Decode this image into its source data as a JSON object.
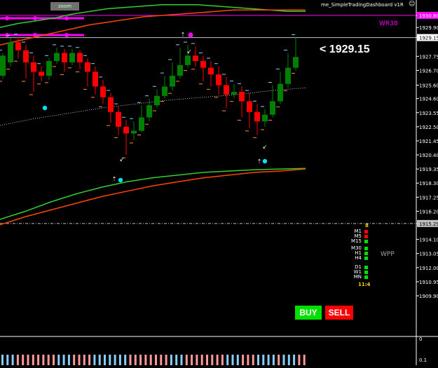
{
  "indicator_title": "me_SimpleTradingDashboard v1R",
  "indicator_button": "zoom",
  "current_price_label": "< 1929.15",
  "wr_label": "WR38",
  "wpp_label": "WPP",
  "buy_label": "BUY",
  "sell_label": "SELL",
  "price_axis": {
    "labels": [
      "1930.80",
      "1929.90",
      "1929.15",
      "1927.75",
      "1926.70",
      "1925.60",
      "1924.60",
      "1923.55",
      "1922.50",
      "1921.45",
      "1920.40",
      "1919.35",
      "1918.30",
      "1917.25",
      "1916.20",
      "1915.29",
      "1914.10",
      "1913.05",
      "1912.00",
      "1910.95",
      "1909.90"
    ]
  },
  "wr_price": "1930.80",
  "current_price": "1929.15",
  "wpp_price": "1915.29",
  "sub_axis": {
    "top": "0",
    "bottom": "0.1"
  },
  "dashboard": {
    "header": "8",
    "rows": [
      {
        "tf": "M1",
        "color": "#ff0000"
      },
      {
        "tf": "M5",
        "color": "#ff0000"
      },
      {
        "tf": "M15",
        "color": "#00e000"
      },
      {
        "tf": "M30",
        "color": "#00e000"
      },
      {
        "tf": "H1",
        "color": "#00e000"
      },
      {
        "tf": "H4",
        "color": "#00e000"
      },
      {
        "tf": "D1",
        "color": "#00e000"
      },
      {
        "tf": "W1",
        "color": "#00e000"
      },
      {
        "tf": "MN",
        "color": "#00e000"
      }
    ],
    "timer": "11:4"
  },
  "colors": {
    "bull": "#008000",
    "bear": "#ff0000",
    "ma_fast": "#32cd32",
    "ma_slow": "#ff4500",
    "magenta": "#ff00ff",
    "dot": "#00e0ff",
    "wick_bull": "#87cefa",
    "wick_bear": "#ff8c40",
    "sub_bull": "#87cefa",
    "sub_bear": "#ff9999"
  },
  "chart_data": {
    "type": "candlestick",
    "candles": [
      {
        "o": 1926.3,
        "c": 1927.8,
        "h": 1928.0,
        "l": 1926.1
      },
      {
        "o": 1927.3,
        "c": 1928.8,
        "h": 1929.1,
        "l": 1927.0
      },
      {
        "o": 1928.8,
        "c": 1928.2,
        "h": 1929.2,
        "l": 1927.6
      },
      {
        "o": 1928.2,
        "c": 1927.3,
        "h": 1928.6,
        "l": 1926.1
      },
      {
        "o": 1927.3,
        "c": 1926.6,
        "h": 1927.8,
        "l": 1925.1
      },
      {
        "o": 1926.6,
        "c": 1926.3,
        "h": 1927.0,
        "l": 1925.9
      },
      {
        "o": 1926.3,
        "c": 1927.4,
        "h": 1927.6,
        "l": 1926.0
      },
      {
        "o": 1927.4,
        "c": 1928.0,
        "h": 1928.4,
        "l": 1927.2
      },
      {
        "o": 1928.0,
        "c": 1927.3,
        "h": 1928.3,
        "l": 1926.6
      },
      {
        "o": 1927.3,
        "c": 1928.0,
        "h": 1928.3,
        "l": 1927.1
      },
      {
        "o": 1928.0,
        "c": 1927.3,
        "h": 1928.2,
        "l": 1926.8
      },
      {
        "o": 1927.3,
        "c": 1926.6,
        "h": 1927.6,
        "l": 1925.5
      },
      {
        "o": 1926.6,
        "c": 1925.5,
        "h": 1927.0,
        "l": 1924.9
      },
      {
        "o": 1925.5,
        "c": 1924.7,
        "h": 1926.0,
        "l": 1924.2
      },
      {
        "o": 1924.7,
        "c": 1923.6,
        "h": 1925.0,
        "l": 1922.8
      },
      {
        "o": 1923.6,
        "c": 1922.5,
        "h": 1924.0,
        "l": 1921.9
      },
      {
        "o": 1922.5,
        "c": 1922.0,
        "h": 1923.0,
        "l": 1920.4
      },
      {
        "o": 1922.0,
        "c": 1922.2,
        "h": 1922.9,
        "l": 1921.5
      },
      {
        "o": 1922.2,
        "c": 1923.2,
        "h": 1924.1,
        "l": 1922.1
      },
      {
        "o": 1923.2,
        "c": 1924.1,
        "h": 1924.6,
        "l": 1922.9
      },
      {
        "o": 1924.1,
        "c": 1924.8,
        "h": 1925.3,
        "l": 1923.9
      },
      {
        "o": 1924.8,
        "c": 1925.5,
        "h": 1926.3,
        "l": 1924.6
      },
      {
        "o": 1925.5,
        "c": 1926.3,
        "h": 1927.3,
        "l": 1925.2
      },
      {
        "o": 1926.3,
        "c": 1927.1,
        "h": 1928.4,
        "l": 1926.1
      },
      {
        "o": 1927.1,
        "c": 1927.8,
        "h": 1928.6,
        "l": 1926.9
      },
      {
        "o": 1927.8,
        "c": 1927.4,
        "h": 1928.5,
        "l": 1927.0
      },
      {
        "o": 1927.4,
        "c": 1926.9,
        "h": 1927.8,
        "l": 1925.9
      },
      {
        "o": 1926.9,
        "c": 1926.4,
        "h": 1927.4,
        "l": 1925.5
      },
      {
        "o": 1926.4,
        "c": 1925.6,
        "h": 1927.0,
        "l": 1924.9
      },
      {
        "o": 1925.6,
        "c": 1924.9,
        "h": 1926.2,
        "l": 1923.9
      },
      {
        "o": 1924.9,
        "c": 1925.1,
        "h": 1925.7,
        "l": 1924.6
      },
      {
        "o": 1925.1,
        "c": 1924.4,
        "h": 1925.5,
        "l": 1923.2
      },
      {
        "o": 1924.4,
        "c": 1923.6,
        "h": 1925.0,
        "l": 1922.4
      },
      {
        "o": 1923.6,
        "c": 1922.9,
        "h": 1924.2,
        "l": 1921.9
      },
      {
        "o": 1922.9,
        "c": 1923.4,
        "h": 1923.8,
        "l": 1922.5
      },
      {
        "o": 1923.4,
        "c": 1924.4,
        "h": 1925.6,
        "l": 1923.2
      },
      {
        "o": 1924.4,
        "c": 1925.7,
        "h": 1926.6,
        "l": 1924.2
      },
      {
        "o": 1925.7,
        "c": 1926.9,
        "h": 1928.0,
        "l": 1925.4
      },
      {
        "o": 1926.9,
        "c": 1927.7,
        "h": 1929.15,
        "l": 1926.7
      }
    ],
    "ma_fast_upper": [
      1929.9,
      1930.2,
      1930.4,
      1930.6,
      1930.9,
      1931.1,
      1931.3,
      1931.4,
      1931.5,
      1931.6,
      1931.6,
      1931.6,
      1931.5,
      1931.4,
      1931.3,
      1931.2,
      1931.1,
      1931.1
    ],
    "ma_slow_upper": [
      1928.6,
      1928.9,
      1929.2,
      1929.5,
      1929.8,
      1930.1,
      1930.3,
      1930.5,
      1930.7,
      1930.8,
      1930.9,
      1931.0,
      1931.1,
      1931.2,
      1931.2,
      1931.2,
      1931.2,
      1931.2
    ],
    "ma_fast_lower": [
      1915.6,
      1916.2,
      1916.9,
      1917.5,
      1918.0,
      1918.4,
      1918.7,
      1918.9,
      1919.1,
      1919.2,
      1919.3,
      1919.35,
      1919.4
    ],
    "ma_slow_lower": [
      1915.2,
      1915.8,
      1916.3,
      1916.8,
      1917.3,
      1917.7,
      1918.1,
      1918.4,
      1918.7,
      1918.9,
      1919.1,
      1919.2,
      1919.35
    ],
    "ma_dotted": [
      1922.6,
      1923.1,
      1923.5,
      1923.9,
      1924.2,
      1924.5,
      1924.7,
      1924.9,
      1925.2,
      1925.4
    ]
  }
}
